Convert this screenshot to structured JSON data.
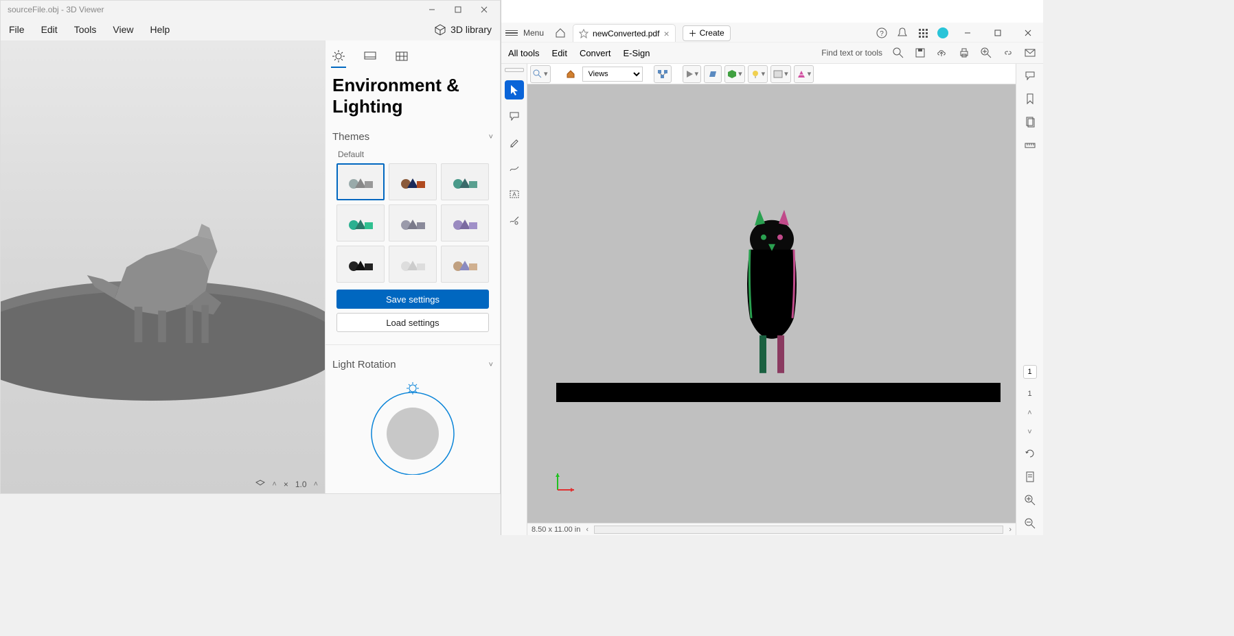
{
  "viewer": {
    "title": "sourceFile.obj - 3D Viewer",
    "menus": [
      "File",
      "Edit",
      "Tools",
      "View",
      "Help"
    ],
    "library_label": "3D library",
    "panel": {
      "title": "Environment & Lighting",
      "themes_section": "Themes",
      "themes_label": "Default",
      "save_btn": "Save settings",
      "load_btn": "Load settings",
      "light_rotation": "Light Rotation"
    },
    "status": {
      "scale_prefix": "×",
      "scale_value": "1.0"
    }
  },
  "acrobat": {
    "menu_label": "Menu",
    "doc_tab": "newConverted.pdf",
    "create_label": "Create",
    "toolbar": {
      "all_tools": "All tools",
      "edit": "Edit",
      "convert": "Convert",
      "esign": "E-Sign",
      "find": "Find text or tools"
    },
    "views_label": "Views",
    "page_size": "8.50 x 11.00 in",
    "page_current": "1",
    "page_total": "1"
  }
}
